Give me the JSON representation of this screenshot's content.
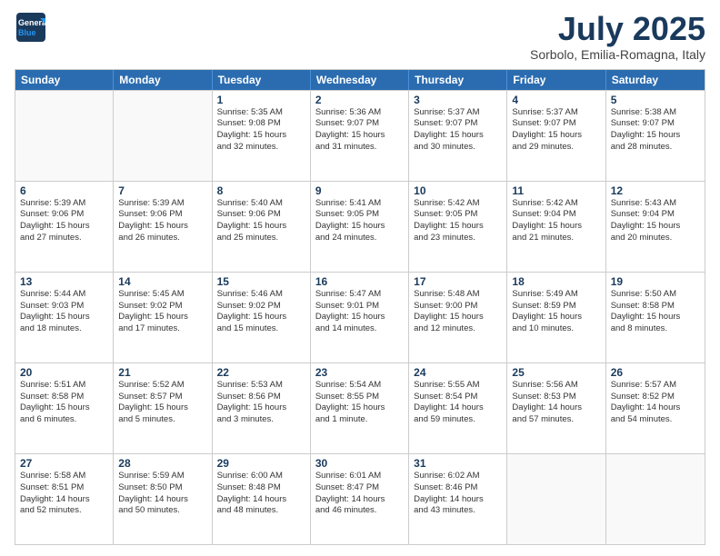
{
  "header": {
    "logo_general": "General",
    "logo_blue": "Blue",
    "title": "July 2025",
    "subtitle": "Sorbolo, Emilia-Romagna, Italy"
  },
  "weekdays": [
    "Sunday",
    "Monday",
    "Tuesday",
    "Wednesday",
    "Thursday",
    "Friday",
    "Saturday"
  ],
  "weeks": [
    [
      {
        "day": "",
        "lines": []
      },
      {
        "day": "",
        "lines": []
      },
      {
        "day": "1",
        "lines": [
          "Sunrise: 5:35 AM",
          "Sunset: 9:08 PM",
          "Daylight: 15 hours",
          "and 32 minutes."
        ]
      },
      {
        "day": "2",
        "lines": [
          "Sunrise: 5:36 AM",
          "Sunset: 9:07 PM",
          "Daylight: 15 hours",
          "and 31 minutes."
        ]
      },
      {
        "day": "3",
        "lines": [
          "Sunrise: 5:37 AM",
          "Sunset: 9:07 PM",
          "Daylight: 15 hours",
          "and 30 minutes."
        ]
      },
      {
        "day": "4",
        "lines": [
          "Sunrise: 5:37 AM",
          "Sunset: 9:07 PM",
          "Daylight: 15 hours",
          "and 29 minutes."
        ]
      },
      {
        "day": "5",
        "lines": [
          "Sunrise: 5:38 AM",
          "Sunset: 9:07 PM",
          "Daylight: 15 hours",
          "and 28 minutes."
        ]
      }
    ],
    [
      {
        "day": "6",
        "lines": [
          "Sunrise: 5:39 AM",
          "Sunset: 9:06 PM",
          "Daylight: 15 hours",
          "and 27 minutes."
        ]
      },
      {
        "day": "7",
        "lines": [
          "Sunrise: 5:39 AM",
          "Sunset: 9:06 PM",
          "Daylight: 15 hours",
          "and 26 minutes."
        ]
      },
      {
        "day": "8",
        "lines": [
          "Sunrise: 5:40 AM",
          "Sunset: 9:06 PM",
          "Daylight: 15 hours",
          "and 25 minutes."
        ]
      },
      {
        "day": "9",
        "lines": [
          "Sunrise: 5:41 AM",
          "Sunset: 9:05 PM",
          "Daylight: 15 hours",
          "and 24 minutes."
        ]
      },
      {
        "day": "10",
        "lines": [
          "Sunrise: 5:42 AM",
          "Sunset: 9:05 PM",
          "Daylight: 15 hours",
          "and 23 minutes."
        ]
      },
      {
        "day": "11",
        "lines": [
          "Sunrise: 5:42 AM",
          "Sunset: 9:04 PM",
          "Daylight: 15 hours",
          "and 21 minutes."
        ]
      },
      {
        "day": "12",
        "lines": [
          "Sunrise: 5:43 AM",
          "Sunset: 9:04 PM",
          "Daylight: 15 hours",
          "and 20 minutes."
        ]
      }
    ],
    [
      {
        "day": "13",
        "lines": [
          "Sunrise: 5:44 AM",
          "Sunset: 9:03 PM",
          "Daylight: 15 hours",
          "and 18 minutes."
        ]
      },
      {
        "day": "14",
        "lines": [
          "Sunrise: 5:45 AM",
          "Sunset: 9:02 PM",
          "Daylight: 15 hours",
          "and 17 minutes."
        ]
      },
      {
        "day": "15",
        "lines": [
          "Sunrise: 5:46 AM",
          "Sunset: 9:02 PM",
          "Daylight: 15 hours",
          "and 15 minutes."
        ]
      },
      {
        "day": "16",
        "lines": [
          "Sunrise: 5:47 AM",
          "Sunset: 9:01 PM",
          "Daylight: 15 hours",
          "and 14 minutes."
        ]
      },
      {
        "day": "17",
        "lines": [
          "Sunrise: 5:48 AM",
          "Sunset: 9:00 PM",
          "Daylight: 15 hours",
          "and 12 minutes."
        ]
      },
      {
        "day": "18",
        "lines": [
          "Sunrise: 5:49 AM",
          "Sunset: 8:59 PM",
          "Daylight: 15 hours",
          "and 10 minutes."
        ]
      },
      {
        "day": "19",
        "lines": [
          "Sunrise: 5:50 AM",
          "Sunset: 8:58 PM",
          "Daylight: 15 hours",
          "and 8 minutes."
        ]
      }
    ],
    [
      {
        "day": "20",
        "lines": [
          "Sunrise: 5:51 AM",
          "Sunset: 8:58 PM",
          "Daylight: 15 hours",
          "and 6 minutes."
        ]
      },
      {
        "day": "21",
        "lines": [
          "Sunrise: 5:52 AM",
          "Sunset: 8:57 PM",
          "Daylight: 15 hours",
          "and 5 minutes."
        ]
      },
      {
        "day": "22",
        "lines": [
          "Sunrise: 5:53 AM",
          "Sunset: 8:56 PM",
          "Daylight: 15 hours",
          "and 3 minutes."
        ]
      },
      {
        "day": "23",
        "lines": [
          "Sunrise: 5:54 AM",
          "Sunset: 8:55 PM",
          "Daylight: 15 hours",
          "and 1 minute."
        ]
      },
      {
        "day": "24",
        "lines": [
          "Sunrise: 5:55 AM",
          "Sunset: 8:54 PM",
          "Daylight: 14 hours",
          "and 59 minutes."
        ]
      },
      {
        "day": "25",
        "lines": [
          "Sunrise: 5:56 AM",
          "Sunset: 8:53 PM",
          "Daylight: 14 hours",
          "and 57 minutes."
        ]
      },
      {
        "day": "26",
        "lines": [
          "Sunrise: 5:57 AM",
          "Sunset: 8:52 PM",
          "Daylight: 14 hours",
          "and 54 minutes."
        ]
      }
    ],
    [
      {
        "day": "27",
        "lines": [
          "Sunrise: 5:58 AM",
          "Sunset: 8:51 PM",
          "Daylight: 14 hours",
          "and 52 minutes."
        ]
      },
      {
        "day": "28",
        "lines": [
          "Sunrise: 5:59 AM",
          "Sunset: 8:50 PM",
          "Daylight: 14 hours",
          "and 50 minutes."
        ]
      },
      {
        "day": "29",
        "lines": [
          "Sunrise: 6:00 AM",
          "Sunset: 8:48 PM",
          "Daylight: 14 hours",
          "and 48 minutes."
        ]
      },
      {
        "day": "30",
        "lines": [
          "Sunrise: 6:01 AM",
          "Sunset: 8:47 PM",
          "Daylight: 14 hours",
          "and 46 minutes."
        ]
      },
      {
        "day": "31",
        "lines": [
          "Sunrise: 6:02 AM",
          "Sunset: 8:46 PM",
          "Daylight: 14 hours",
          "and 43 minutes."
        ]
      },
      {
        "day": "",
        "lines": []
      },
      {
        "day": "",
        "lines": []
      }
    ]
  ]
}
